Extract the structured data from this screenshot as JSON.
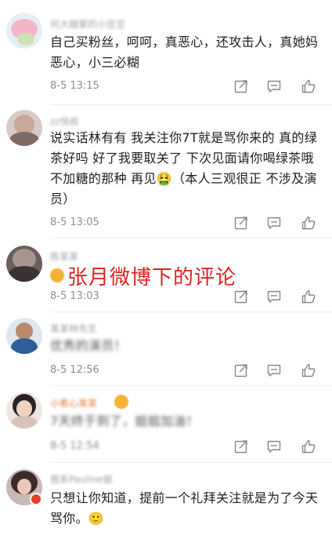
{
  "overlay_caption": "张月微博下的评论",
  "icons": {
    "share": "share-icon",
    "reply": "reply-icon",
    "like": "like-icon"
  },
  "colors": {
    "caption": "#e0231f",
    "meta": "#8e8e8e",
    "icon": "#888888"
  },
  "comments": [
    {
      "username": "何大嫂家的小豆豆",
      "text": "自己买粉丝，呵呵，真恶心，还攻击人，真她妈恶心，小三必糊",
      "time": "8-5 13:15"
    },
    {
      "username": "zz悦叔",
      "text": "说实话林有有  我关注你7T就是骂你来的  真的绿茶好吗  好了我要取关了  下次见面请你喝绿茶哦不加糖的那种  再见🤮（本人三观很正  不涉及演员）",
      "time": "8-5 13:05"
    },
    {
      "username": "陈某某",
      "text": "",
      "time": "8-5 13:03"
    },
    {
      "username": "某某林先生",
      "text": "优秀的演员！",
      "time": "8-5 12:56"
    },
    {
      "username": "小肴心某某",
      "text": "7天终于到了，姐姐加油！",
      "time": "8-5 12:54"
    },
    {
      "username": "我系Pauline姐",
      "text": "只想让你知道，提前一个礼拜关注就是为了今天骂你。🙂",
      "time": ""
    }
  ]
}
